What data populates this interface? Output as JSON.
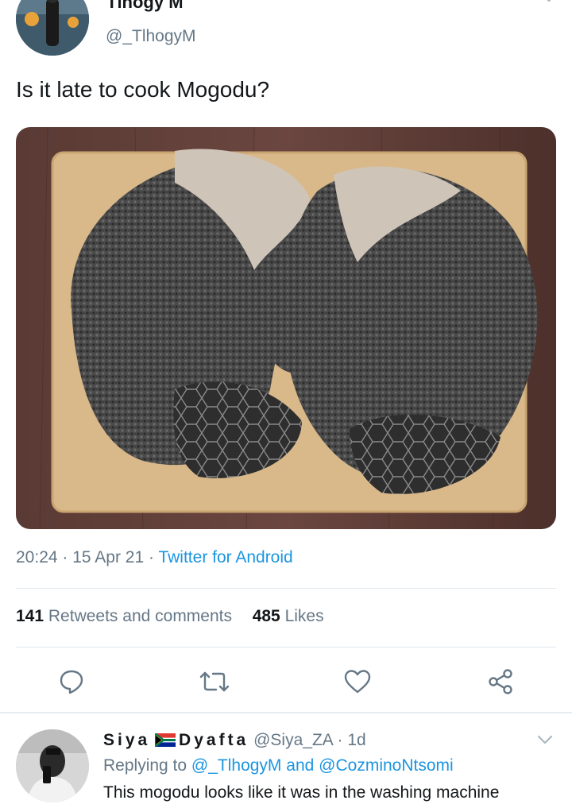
{
  "tweet": {
    "author_name": "Tlhogy M",
    "author_handle": "@_TlhogyM",
    "text": "Is it late to cook Mogodu?",
    "time": "20:24",
    "date": "15 Apr 21",
    "source": "Twitter for Android",
    "separator": "·"
  },
  "stats": {
    "retweets_count": "141",
    "retweets_label": "Retweets and comments",
    "likes_count": "485",
    "likes_label": "Likes"
  },
  "actions": {
    "icons": [
      "reply-icon",
      "retweet-icon",
      "like-icon",
      "share-icon"
    ]
  },
  "reply": {
    "name_part1": "Siya",
    "name_part2": "Dyafta",
    "handle": "@Siya_ZA",
    "age": "1d",
    "separator": "·",
    "replying_prefix": "Replying to",
    "replying_user1": "@_TlhogyM",
    "replying_and": "and",
    "replying_user2": "@CozminoNtsomi",
    "text": "This mogodu looks like it was in the washing machine"
  },
  "colors": {
    "link": "#1b95e0",
    "secondary_text": "#657786",
    "primary_text": "#14171a",
    "icon": "#657786",
    "divider": "#e1e8ed"
  }
}
